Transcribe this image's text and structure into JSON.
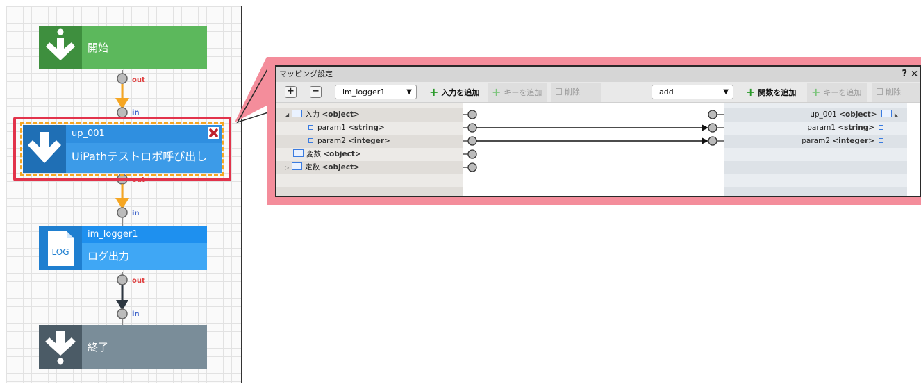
{
  "flow": {
    "start": {
      "label": "開始"
    },
    "robot": {
      "id": "up_001",
      "name": "UiPathテストロボ呼び出し"
    },
    "logger": {
      "id": "im_logger1",
      "name": "ログ出力",
      "icon_text": "LOG"
    },
    "end": {
      "label": "終了"
    },
    "ports": {
      "out": "out",
      "in": "in"
    }
  },
  "mapping": {
    "title": "マッピング設定",
    "help": "?",
    "close": "×",
    "toolbar": {
      "left_select": "im_logger1",
      "add_input": "入力を追加",
      "add_key_left": "キーを追加",
      "delete_left": "削除",
      "right_select": "add",
      "add_function": "関数を追加",
      "add_key_right": "キーを追加",
      "delete_right": "削除"
    },
    "source_tree": [
      {
        "label": "入力",
        "type": "<object>",
        "kind": "folder",
        "expander": "open"
      },
      {
        "label": "param1",
        "type": "<string>",
        "kind": "item"
      },
      {
        "label": "param2",
        "type": "<integer>",
        "kind": "item"
      },
      {
        "label": "変数",
        "type": "<object>",
        "kind": "folder",
        "expander": "none"
      },
      {
        "label": "定数",
        "type": "<object>",
        "kind": "folder",
        "expander": "closed"
      }
    ],
    "target_tree": [
      {
        "label": "up_001",
        "type": "<object>",
        "kind": "folder"
      },
      {
        "label": "param1",
        "type": "<string>",
        "kind": "item"
      },
      {
        "label": "param2",
        "type": "<integer>",
        "kind": "item"
      }
    ]
  },
  "colors": {
    "start_green": "#5cb85c",
    "start_icon_green": "#3e8f3e",
    "robot_blue": "#2f8fe0",
    "selection_red": "#e2334b",
    "logger_blue": "#3fa7f5",
    "end_gray": "#7a8d99",
    "callout_pink": "#f48d9b",
    "connector_orange": "#f5a623"
  }
}
